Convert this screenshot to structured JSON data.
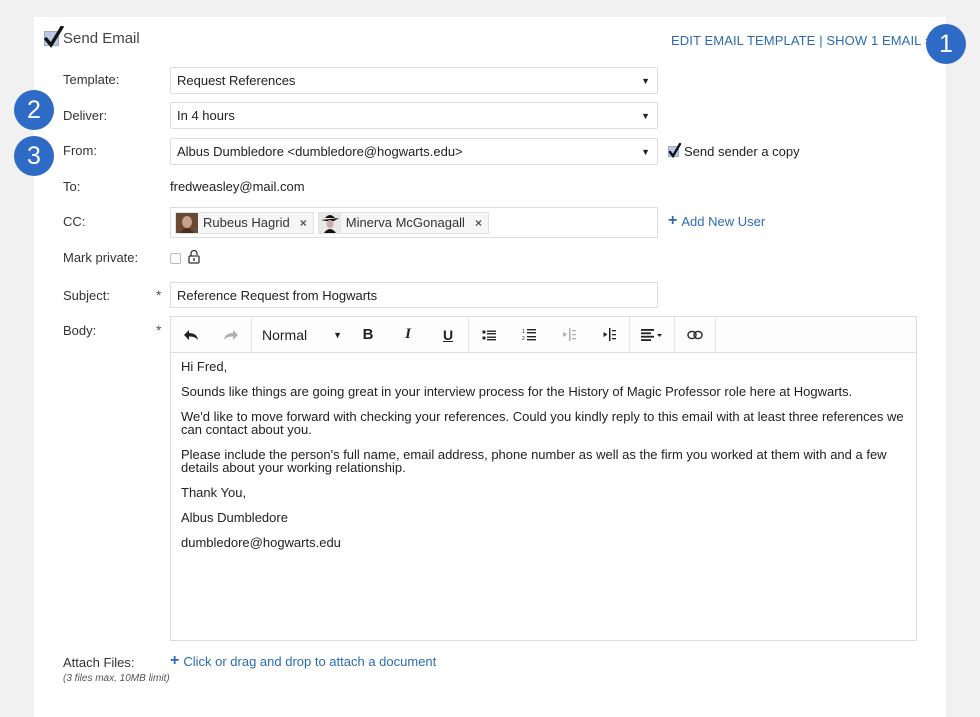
{
  "header": {
    "title": "Send Email",
    "send_checked": true,
    "edit_template_link": "EDIT EMAIL TEMPLATE",
    "separator": "|",
    "show_emails_link": "SHOW 1 EMAIL ››"
  },
  "badges": [
    "1",
    "2",
    "3"
  ],
  "form": {
    "template": {
      "label": "Template:",
      "value": "Request References"
    },
    "deliver": {
      "label": "Deliver:",
      "value": "In 4 hours"
    },
    "from": {
      "label": "From:",
      "value": "Albus Dumbledore <dumbledore@hogwarts.edu>",
      "send_copy_label": "Send sender a copy",
      "send_copy_checked": true
    },
    "to": {
      "label": "To:",
      "value": "fredweasley@mail.com"
    },
    "cc": {
      "label": "CC:",
      "recipients": [
        {
          "name": "Rubeus Hagrid",
          "remove_icon": "×"
        },
        {
          "name": "Minerva McGonagall",
          "remove_icon": "×"
        }
      ],
      "add_user_label": "Add New User"
    },
    "mark_private": {
      "label": "Mark private:",
      "checked": false,
      "icon": "lock-icon"
    },
    "subject": {
      "label": "Subject:",
      "required_mark": "*",
      "value": "Reference Request from Hogwarts"
    },
    "body": {
      "label": "Body:",
      "required_mark": "*",
      "toolbar": {
        "undo": "undo-icon",
        "redo": "redo-icon",
        "format_value": "Normal",
        "bold": "B",
        "italic": "I",
        "underline": "U",
        "bullet_list": "bullet-list-icon",
        "numbered_list": "numbered-list-icon",
        "outdent": "outdent-icon",
        "indent": "indent-icon",
        "align": "align-icon",
        "link": "link-icon"
      },
      "paragraphs": [
        "Hi Fred,",
        "Sounds like things are going great in your interview process for the History of Magic Professor role here at Hogwarts.",
        "We'd like to move forward with checking your references. Could you kindly reply to this email with at least three references we can contact about you.",
        "Please include the person's full name, email address, phone number as well as the firm you worked at them with and a few details about your working relationship.",
        "Thank You,",
        "Albus Dumbledore",
        "dumbledore@hogwarts.edu"
      ]
    },
    "attach": {
      "label": "Attach Files:",
      "note": "(3 files max, 10MB limit)",
      "link": "Click or drag and drop to attach a document"
    }
  },
  "colors": {
    "accent": "#2b6cb0",
    "badge": "#2e6bc6",
    "background": "#f1f1f1"
  }
}
